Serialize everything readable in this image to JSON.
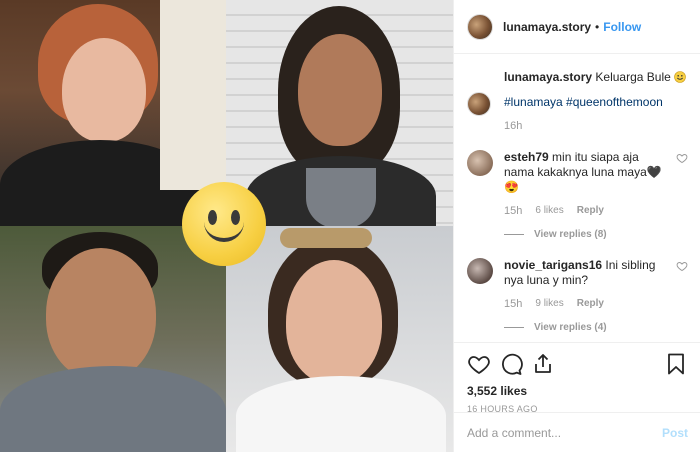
{
  "post": {
    "username": "lunamaya.story",
    "follow_sep": "•",
    "follow_label": "Follow",
    "caption_user": "lunamaya.story",
    "caption_text": "Keluarga Bule",
    "hashtags": "#lunamaya #queenofthemoon",
    "caption_time": "16h",
    "likes": "3,552 likes",
    "timestamp": "16 HOURS AGO",
    "comment_placeholder": "Add a comment...",
    "post_label": "Post"
  },
  "comments": [
    {
      "user": "esteh79",
      "text": "min itu siapa aja nama kakaknya luna maya🖤😍",
      "time": "15h",
      "likes": "6 likes",
      "reply": "Reply",
      "view_replies": "View replies (8)"
    },
    {
      "user": "novie_tarigans16",
      "text": "Ini sibling nya luna y min?",
      "time": "15h",
      "likes": "9 likes",
      "reply": "Reply",
      "view_replies": "View replies (4)"
    }
  ],
  "icons": {
    "like": "heart-icon",
    "comment": "comment-icon",
    "share": "share-icon",
    "save": "bookmark-icon"
  },
  "colors": {
    "accent": "#3897f0",
    "hashtag": "#003569",
    "muted": "#999999",
    "post_disabled": "#b2dffc"
  }
}
